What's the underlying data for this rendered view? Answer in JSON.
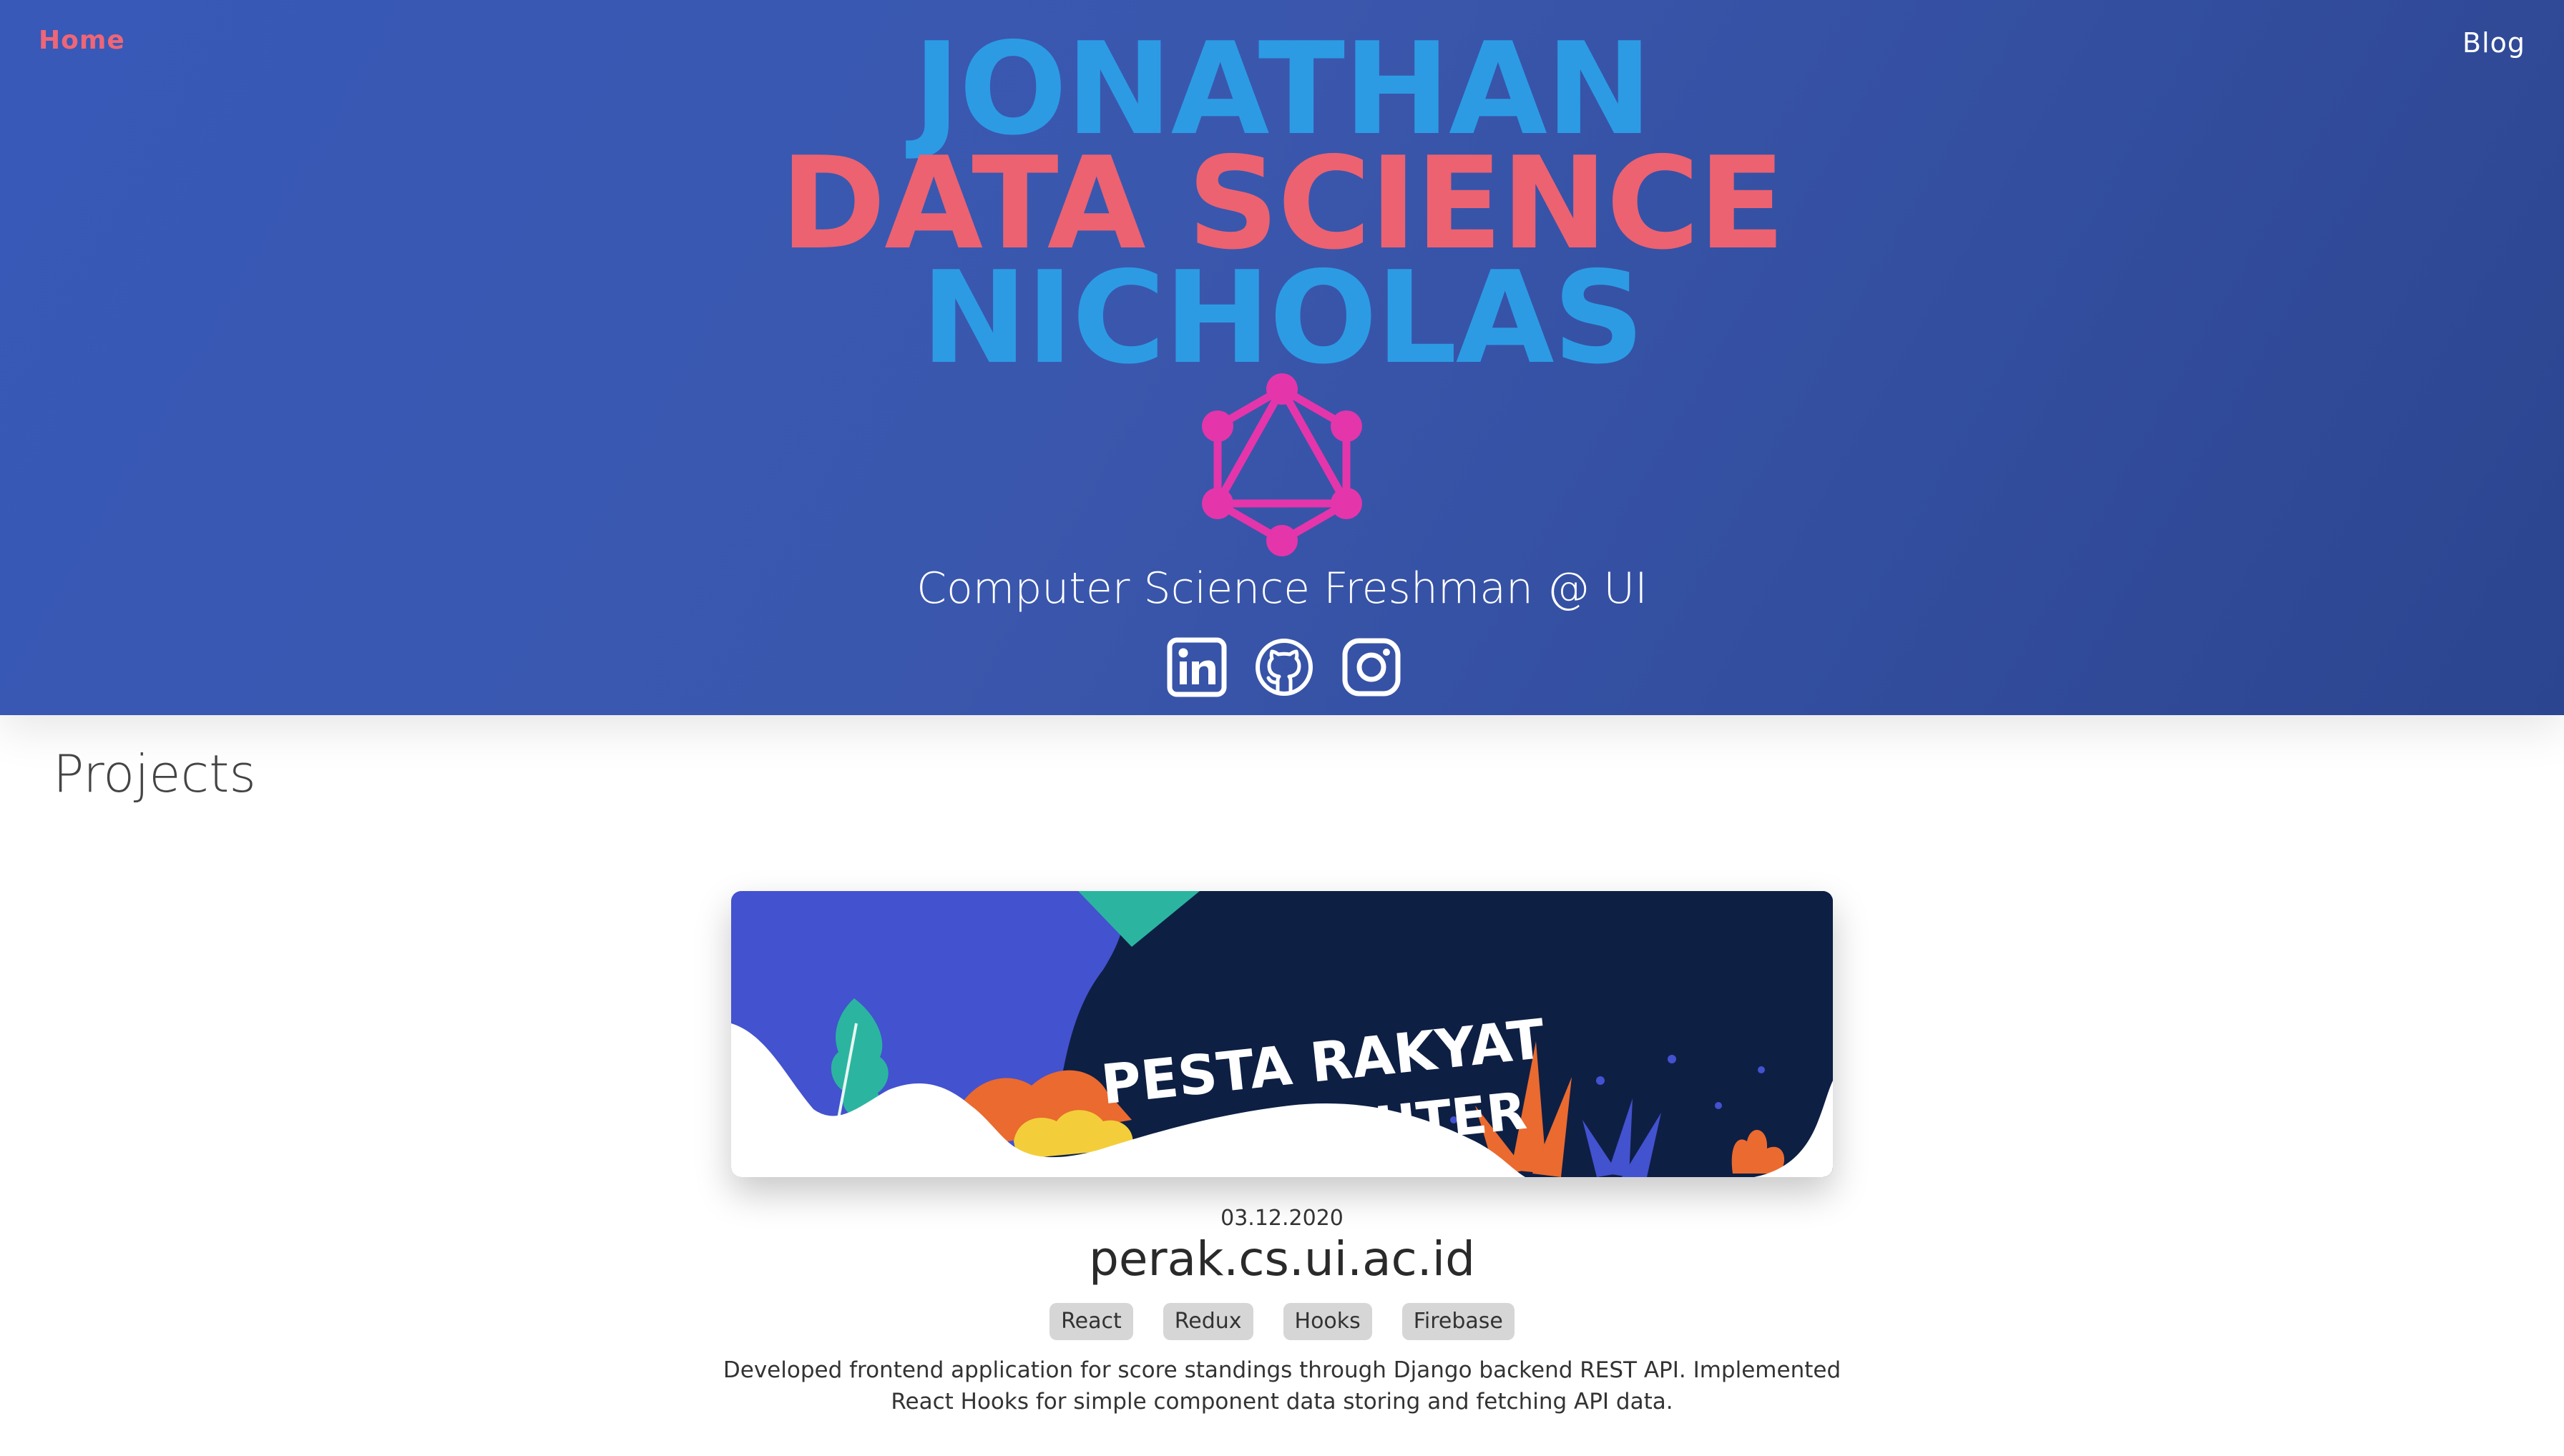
{
  "nav": {
    "home_label": "Home",
    "blog_label": "Blog"
  },
  "hero": {
    "title_first": "JONATHAN",
    "title_middle": "DATA SCIENCE",
    "title_last": "NICHOLAS",
    "logo_icon": "graphql-icon",
    "subtitle": "Computer Science Freshman @ UI",
    "socials": [
      {
        "icon": "linkedin-icon"
      },
      {
        "icon": "github-icon"
      },
      {
        "icon": "instagram-icon"
      }
    ],
    "colors": {
      "primary_blue": "#2c9be4",
      "accent_pink": "#ec6271",
      "logo_magenta": "#e535ab",
      "background": "#3a57ad"
    }
  },
  "projects": {
    "title": "Projects",
    "items": [
      {
        "banner_text_line1": "PESTA RAKYAT",
        "banner_text_line2": "KOMPUTER",
        "date": "03.12.2020",
        "name": "perak.cs.ui.ac.id",
        "tags": [
          "React",
          "Redux",
          "Hooks",
          "Firebase"
        ],
        "description": "Developed frontend application for score standings through Django backend REST API. Implemented React Hooks for simple component data storing and fetching API data."
      }
    ]
  }
}
